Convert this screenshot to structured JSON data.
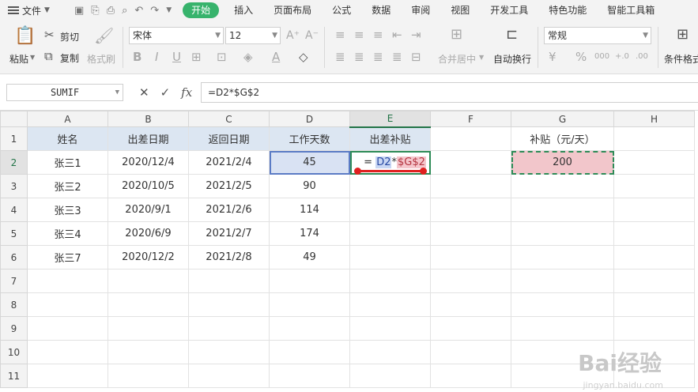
{
  "menubar": {
    "file": "文件",
    "tabs": [
      "开始",
      "插入",
      "页面布局",
      "公式",
      "数据",
      "审阅",
      "视图",
      "开发工具",
      "特色功能",
      "智能工具箱"
    ]
  },
  "ribbon": {
    "paste": "粘贴",
    "cut": "剪切",
    "copy": "复制",
    "format_painter": "格式刷",
    "font_name": "宋体",
    "font_size": "12",
    "merge_center": "合并居中",
    "wrap_text": "自动换行",
    "number_format": "常规",
    "conditional_format": "条件格式",
    "bold": "B",
    "italic": "I",
    "underline": "U",
    "percent": "%",
    "currency": "¥"
  },
  "formula_bar": {
    "name_box": "SUMIF",
    "fx": "fx",
    "formula": "=D2*$G$2"
  },
  "sheet": {
    "columns": [
      "A",
      "B",
      "C",
      "D",
      "E",
      "F",
      "G",
      "H"
    ],
    "rows": [
      "1",
      "2",
      "3",
      "4",
      "5",
      "6",
      "7",
      "8",
      "9",
      "10",
      "11"
    ],
    "headers": {
      "A": "姓名",
      "B": "出差日期",
      "C": "返回日期",
      "D": "工作天数",
      "E": "出差补贴",
      "G": "补贴（元/天）"
    },
    "data": [
      {
        "name": "张三1",
        "out": "2020/12/4",
        "back": "2021/2/4",
        "days": "45"
      },
      {
        "name": "张三2",
        "out": "2020/10/5",
        "back": "2021/2/5",
        "days": "90"
      },
      {
        "name": "张三3",
        "out": "2020/9/1",
        "back": "2021/2/6",
        "days": "114"
      },
      {
        "name": "张三4",
        "out": "2020/6/9",
        "back": "2021/2/7",
        "days": "174"
      },
      {
        "name": "张三7",
        "out": "2020/12/2",
        "back": "2021/2/8",
        "days": "49"
      }
    ],
    "edit_cell": {
      "eq": "=",
      "ref1": "D2",
      "op": "*",
      "ref2": "$G$2"
    },
    "g2": "200"
  },
  "watermark": {
    "brand": "Bai经验",
    "url": "jingyan.baidu.com"
  }
}
